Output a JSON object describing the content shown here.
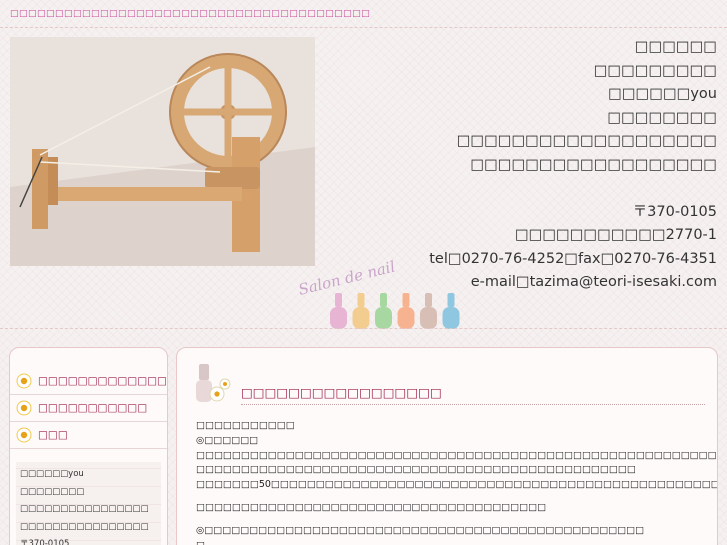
{
  "tagline": "□□□□□□□□□□□□□□□□□□□□□□□□□□□□□□□□□□□□□□□□",
  "header": {
    "photo_alt": "wooden spinning wheel",
    "contact": {
      "line1": "□□□□□□",
      "line2": "□□□□□□□□□",
      "line3": "□□□□□□you",
      "line4": "□□□□□□□□",
      "line5": "□□□□□□□□□□□□□□□□□□□",
      "line6": "□□□□□□□□□□□□□□□□□□",
      "postal": "〒370-0105",
      "address": "□□□□□□□□□□□2770-1",
      "phone": "tel□0270-76-4252□fax□0270-76-4351",
      "email": "e-mail□tazima@teori-isesaki.com"
    },
    "logo_text": "Salon de nail",
    "logo_colors": [
      "#e8b4d4",
      "#f3cc8f",
      "#a8d8a2",
      "#f7b38f",
      "#d8bfb6",
      "#8fc7e0"
    ]
  },
  "sidebar": {
    "nav": [
      {
        "label": "□□□□□□□□□□□□□"
      },
      {
        "label": "□□□□□□□□□□□"
      },
      {
        "label": "□□□"
      }
    ],
    "sub_items": [
      "□□□□□□you",
      "□□□□□□□□",
      "□□□□□□□□□□□□□□□□",
      "□□□□□□□□□□□□□□□□",
      "〒370-0105"
    ]
  },
  "main": {
    "section_title": "□□□□□□□□□□□□□□□□□",
    "lines": [
      "□□□□□□□□□□□",
      "◎□□□□□□",
      "□□□□□□□□□□□□□□□□□□□□□□□□□□□□□□□□□□□□□□□□□□□□□□□□□□□□□□□□□□",
      "□□□□□□□□□□□□□□□□□□□□□□□□□□□□□□□□□□□□□□□□□□□□□□□□□",
      "□□□□□□□50□□□□□□□□□□□□□□□□□□□□□□□□□□□□□□□□□□□□□□□□□□□□□□□□□□□□□□□□□□□",
      "□□□□□□□□□□□□□□□□□□□□□□□□□□□□□□□□□□□□□□□",
      "◎□□□□□□□□□□□□□□□□□□□□□□□□□□□□□□□□□□□□□□□□□□□□□□□□□",
      "□"
    ]
  },
  "colors": {
    "accent": "#9c1f4a",
    "tagline": "#c9479a",
    "border": "#e8c7c7"
  }
}
